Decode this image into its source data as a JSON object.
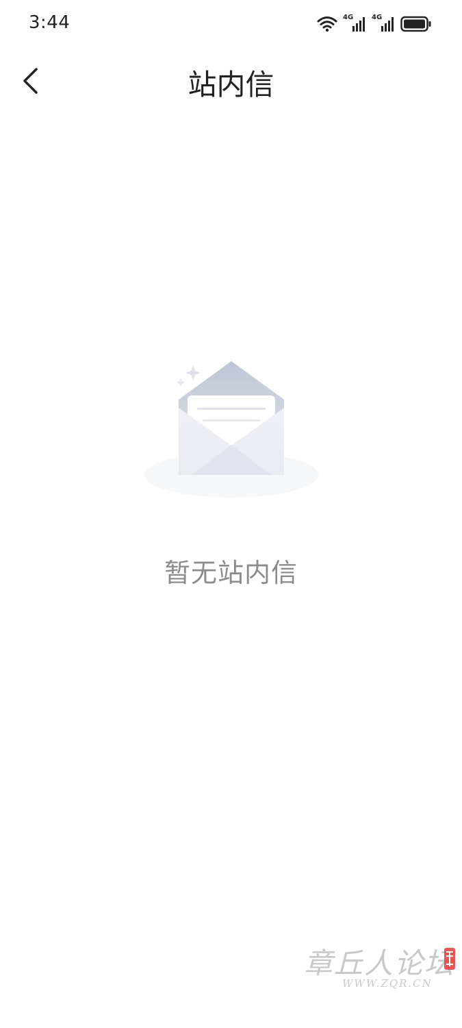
{
  "status_bar": {
    "time": "3:44",
    "network_1": "4G",
    "network_2": "4G",
    "icons": [
      "wifi-icon",
      "signal-4g-icon",
      "signal-4g-icon",
      "battery-icon"
    ]
  },
  "nav": {
    "title": "站内信",
    "back_icon": "chevron-left-icon"
  },
  "empty_state": {
    "illustration": "open-envelope-icon",
    "message": "暂无站内信"
  },
  "watermark": {
    "text": "章丘人论坛",
    "url": "WWW.ZQR.CN"
  },
  "colors": {
    "background": "#ffffff",
    "title": "#222222",
    "empty_text": "#8c8c8c",
    "envelope": "#eef0f5",
    "envelope_flap": "#c7ccd9",
    "seal_red": "#e03c3c"
  }
}
